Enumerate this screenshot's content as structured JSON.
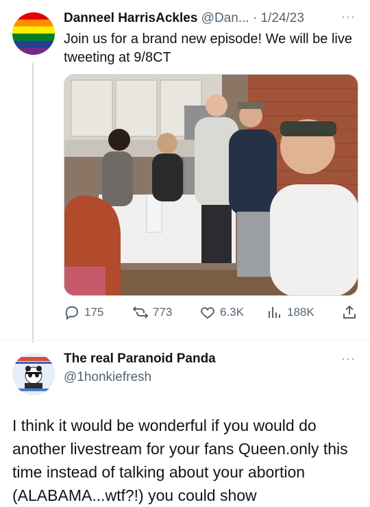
{
  "tweet1": {
    "author_name": "Danneel HarrisAckles",
    "handle": "@Dan...",
    "separator": "·",
    "date": "1/24/23",
    "more_label": "···",
    "text": "Join us for a brand new episode! We will be live tweeting at 9/8CT",
    "media_icon": "photo",
    "metrics": {
      "replies": "175",
      "retweets": "773",
      "likes": "6.3K",
      "views": "188K"
    },
    "icons": [
      "reply-icon",
      "retweet-icon",
      "like-icon",
      "views-icon",
      "share-icon"
    ]
  },
  "tweet2": {
    "author_name": "The real Paranoid Panda",
    "handle": "@1honkiefresh",
    "more_label": "···",
    "text": "I think it would be wonderful if you would do another livestream for your fans Queen.only this time instead of talking about your abortion (ALABAMA...wtf?!) you could show"
  },
  "colors": {
    "secondary_text": "#536471",
    "divider": "#eff3f4",
    "text": "#0f1419"
  }
}
